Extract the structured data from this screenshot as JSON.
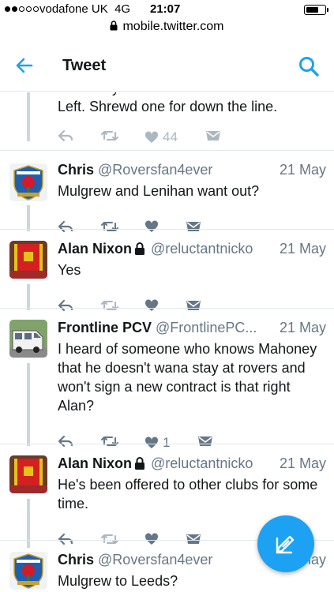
{
  "status_bar": {
    "carrier": "vodafone UK",
    "network": "4G",
    "time": "21:07",
    "battery_level": 0.7
  },
  "url_bar": {
    "url": "mobile.twitter.com"
  },
  "nav": {
    "title": "Tweet",
    "back_icon": "arrow-left-icon",
    "search_icon": "search-icon"
  },
  "colors": {
    "accent": "#1da1f2",
    "muted": "#657786",
    "action": "#aab8c2",
    "line": "#ccd6dd"
  },
  "tweets": [
    {
      "text": "Striker Kyle Connell. Was at Motherwell. Left. Shrewd one for down the line.",
      "likes": "44"
    },
    {
      "name": "Chris",
      "handle": "@Roversfan4ever",
      "date": "21 May",
      "text": "Mulgrew and Lenihan want out?",
      "likes": ""
    },
    {
      "name": "Alan Nixon",
      "handle": "@reluctantnicko",
      "date": "21 May",
      "text": "Yes",
      "protected": true,
      "likes": ""
    },
    {
      "name": "Frontline PCV",
      "handle": "@FrontlinePC...",
      "date": "21 May",
      "text": "I heard of someone who knows Mahoney that he doesn't wana stay at rovers and won't sign a new contract is that right Alan?",
      "likes": "1"
    },
    {
      "name": "Alan Nixon",
      "handle": "@reluctantnicko",
      "date": "21 May",
      "text": "He's been offered to other clubs for some time.",
      "protected": true,
      "likes": ""
    },
    {
      "name": "Chris",
      "handle": "@Roversfan4ever",
      "date": "21 May",
      "text": "Mulgrew to Leeds?",
      "likes": ""
    }
  ],
  "compose_button": {
    "icon": "compose-feather-icon"
  }
}
